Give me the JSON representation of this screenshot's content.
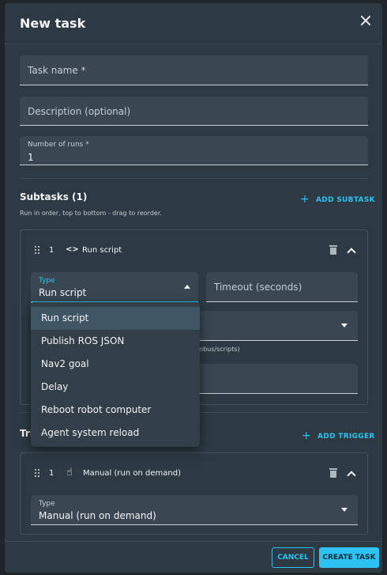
{
  "dialog": {
    "title": "New task"
  },
  "fields": {
    "task_name_placeholder": "Task name *",
    "description_placeholder": "Description (optional)",
    "runs_label": "Number of runs *",
    "runs_value": "1"
  },
  "subtasks": {
    "title": "Subtasks (1)",
    "hint": "Run in order, top to bottom - drag to reorder.",
    "add_label": "ADD SUBTASK",
    "card": {
      "index": "1",
      "code_icon": "<>",
      "name": "Run script",
      "type_label": "Type",
      "type_value": "Run script",
      "timeout_placeholder": "Timeout (seconds)",
      "path_hint_partial": "nbus/scripts)"
    }
  },
  "type_menu": {
    "items": [
      "Run script",
      "Publish ROS JSON",
      "Nav2 goal",
      "Delay",
      "Reboot robot computer",
      "Agent system reload"
    ]
  },
  "triggers": {
    "title_partial": "Tri",
    "add_label": "ADD TRIGGER",
    "card": {
      "index": "1",
      "name": "Manual (run on demand)",
      "type_label": "Type",
      "type_value": "Manual (run on demand)"
    }
  },
  "footer": {
    "cancel_label": "CANCEL",
    "create_label": "CREATE TASK"
  },
  "colors": {
    "accent": "#2ec2f2",
    "dialog_bg": "#2d3a44",
    "field_bg": "#3a4752"
  }
}
